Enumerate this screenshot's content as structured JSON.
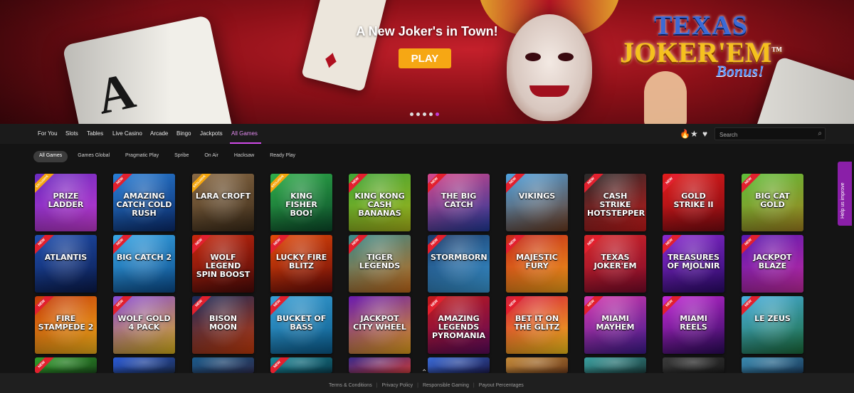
{
  "hero": {
    "title": "A New Joker's in Town!",
    "play_label": "PLAY",
    "promo_line1": "TEXAS",
    "promo_line2": "JOKER'EM",
    "promo_line3": "Bonus!",
    "promo_tm": "TM",
    "ace_letter": "A",
    "slides": 5,
    "active_slide": 5
  },
  "nav": {
    "items": [
      "For You",
      "Slots",
      "Tables",
      "Live Casino",
      "Arcade",
      "Bingo",
      "Jackpots",
      "All Games"
    ],
    "active": "All Games",
    "search_placeholder": "Search"
  },
  "filters": {
    "items": [
      "All Games",
      "Games Global",
      "Pragmatic Play",
      "Spribe",
      "On Air",
      "Hacksaw",
      "Ready Play"
    ],
    "active": "All Games"
  },
  "games": [
    {
      "name": "PRIZE LADDER",
      "badge": "EXCLUSIVE",
      "c1": "#6b2bbf",
      "c2": "#c43ad0"
    },
    {
      "name": "AMAZING CATCH COLD RUSH",
      "badge": "NEW",
      "c1": "#2a7fd6",
      "c2": "#0a2a6b"
    },
    {
      "name": "LARA CROFT",
      "badge": "EXCLUSIVE",
      "c1": "#8a6a45",
      "c2": "#3a2a18"
    },
    {
      "name": "KING FISHER BOO!",
      "badge": "EXCLUSIVE",
      "c1": "#2fae4a",
      "c2": "#0b4a2a"
    },
    {
      "name": "KING KONG CASH BANANAS",
      "badge": "NEW",
      "c1": "#3fa535",
      "c2": "#a8b41a"
    },
    {
      "name": "THE BIG CATCH",
      "badge": "NEW",
      "c1": "#d7478a",
      "c2": "#1f3a9a"
    },
    {
      "name": "VIKINGS",
      "badge": "NEW",
      "c1": "#4fa2e0",
      "c2": "#6a3a1f"
    },
    {
      "name": "CASH STRIKE HOTSTEPPER",
      "badge": "NEW",
      "c1": "#2a2a2a",
      "c2": "#c41a1a"
    },
    {
      "name": "GOLD STRIKE II",
      "badge": "NEW",
      "c1": "#e21c1c",
      "c2": "#7a0a10"
    },
    {
      "name": "BIG CAT GOLD",
      "badge": "NEW",
      "c1": "#5fbf3a",
      "c2": "#a0801f"
    },
    {
      "name": "ATLANTIS",
      "badge": "NEW",
      "c1": "#1f4fb0",
      "c2": "#0a1a4a"
    },
    {
      "name": "BIG CATCH 2",
      "badge": "NEW",
      "c1": "#3aa7e6",
      "c2": "#0a4a8a"
    },
    {
      "name": "WOLF LEGEND SPIN BOOST",
      "badge": "NEW",
      "c1": "#c8280e",
      "c2": "#4a0a08"
    },
    {
      "name": "LUCKY FIRE BLITZ",
      "badge": "NEW",
      "c1": "#e24a0a",
      "c2": "#6a0a08"
    },
    {
      "name": "TIGER LEGENDS",
      "badge": "NEW",
      "c1": "#3a8a8a",
      "c2": "#c46a1a"
    },
    {
      "name": "STORMBORN",
      "badge": "NEW",
      "c1": "#1a3a6a",
      "c2": "#3a9ad6"
    },
    {
      "name": "MAJESTIC FURY",
      "badge": "NEW",
      "c1": "#c4261a",
      "c2": "#f2a21a"
    },
    {
      "name": "TEXAS JOKER'EM",
      "badge": "NEW",
      "c1": "#d7262a",
      "c2": "#7a0a2a"
    },
    {
      "name": "TREASURES OF MJOLNIR",
      "badge": "NEW",
      "c1": "#8a2ad0",
      "c2": "#2a0a6a"
    },
    {
      "name": "JACKPOT BLAZE",
      "badge": "NEW",
      "c1": "#5a1ab0",
      "c2": "#c42aa0"
    },
    {
      "name": "FIRE STAMPEDE 2",
      "badge": "NEW",
      "c1": "#c43a0a",
      "c2": "#f2b21a"
    },
    {
      "name": "WOLF GOLD 4 PACK",
      "badge": "NEW",
      "c1": "#8a4ad6",
      "c2": "#d6b01a"
    },
    {
      "name": "BISON MOON",
      "badge": "NEW",
      "c1": "#1a2a5a",
      "c2": "#c43a0a"
    },
    {
      "name": "BUCKET OF BASS",
      "badge": "NEW",
      "c1": "#3aa0d6",
      "c2": "#0a5a8a"
    },
    {
      "name": "JACKPOT CITY WHEEL",
      "badge": "",
      "c1": "#6a1ab0",
      "c2": "#e2a01a"
    },
    {
      "name": "AMAZING LEGENDS PYROMANIA",
      "badge": "NEW",
      "c1": "#c41a1a",
      "c2": "#5a0a5a"
    },
    {
      "name": "BET IT ON THE GLITZ",
      "badge": "NEW",
      "c1": "#d61a3a",
      "c2": "#f2c21a"
    },
    {
      "name": "MIAMI MAYHEM",
      "badge": "NEW",
      "c1": "#d63ab0",
      "c2": "#3a1a8a"
    },
    {
      "name": "MIAMI REELS",
      "badge": "NEW",
      "c1": "#c42ad6",
      "c2": "#2a0a5a"
    },
    {
      "name": "LE ZEUS",
      "badge": "NEW",
      "c1": "#4ab0e0",
      "c2": "#1a6a3a"
    },
    {
      "name": "",
      "badge": "NEW",
      "c1": "#2fa02a",
      "c2": "#1a4a1a"
    },
    {
      "name": "",
      "badge": "",
      "c1": "#2a5ad6",
      "c2": "#1a2a4a"
    },
    {
      "name": "",
      "badge": "",
      "c1": "#1a5a8a",
      "c2": "#2a2a4a"
    },
    {
      "name": "",
      "badge": "NEW",
      "c1": "#1a8a9a",
      "c2": "#0a3a4a"
    },
    {
      "name": "",
      "badge": "",
      "c1": "#3a2a8a",
      "c2": "#c43a3a"
    },
    {
      "name": "",
      "badge": "",
      "c1": "#3a6ad6",
      "c2": "#1a1a4a"
    },
    {
      "name": "",
      "badge": "",
      "c1": "#c48a3a",
      "c2": "#6a3a1a"
    },
    {
      "name": "",
      "badge": "",
      "c1": "#3aa0a0",
      "c2": "#1a3a3a"
    },
    {
      "name": "",
      "badge": "",
      "c1": "#3a3a3a",
      "c2": "#1a1a1a"
    },
    {
      "name": "",
      "badge": "",
      "c1": "#3a8ab0",
      "c2": "#1a3a5a"
    }
  ],
  "footer": {
    "links": [
      "Terms & Conditions",
      "Privacy Policy",
      "Responsible Gaming",
      "Payout Percentages"
    ]
  },
  "feedback": {
    "label": "Help us improve"
  },
  "icons": {
    "fire": "flame-icon",
    "star": "star-icon",
    "heart": "heart-icon",
    "search": "search-icon",
    "chevron": "chevron-up-icon"
  }
}
